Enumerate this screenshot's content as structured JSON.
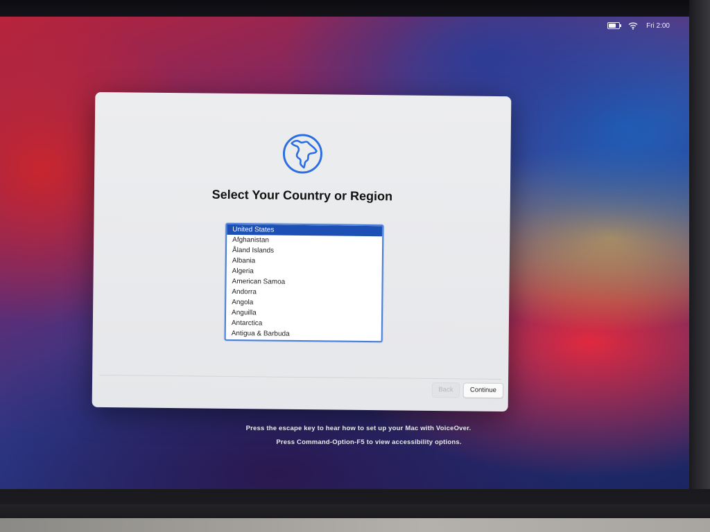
{
  "menu_bar": {
    "clock": "Fri 2:00",
    "icons": [
      "battery-icon",
      "wifi-icon"
    ]
  },
  "setup": {
    "icon": "globe-icon",
    "title": "Select Your Country or Region",
    "countries": [
      "United States",
      "Afghanistan",
      "Åland Islands",
      "Albania",
      "Algeria",
      "American Samoa",
      "Andorra",
      "Angola",
      "Anguilla",
      "Antarctica",
      "Antigua & Barbuda"
    ],
    "selected": "United States",
    "back_label": "Back",
    "continue_label": "Continue"
  },
  "hints": {
    "voiceover": "Press the escape key to hear how to set up your Mac with VoiceOver.",
    "accessibility": "Press Command-Option-F5 to view accessibility options."
  },
  "colors": {
    "accent": "#1d4fb5",
    "globe": "#2d6fe0"
  }
}
